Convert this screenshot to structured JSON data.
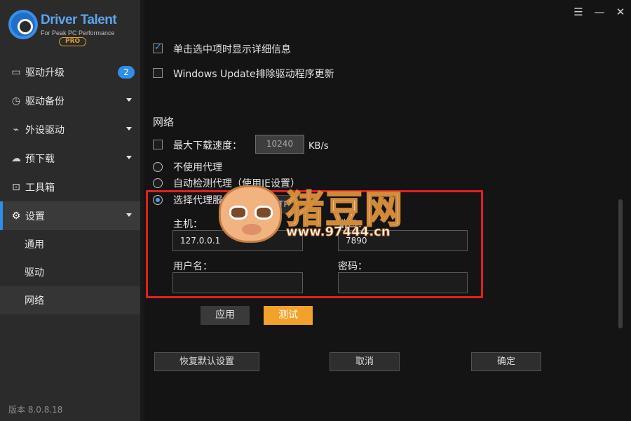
{
  "brand": {
    "title": "Driver Talent",
    "subtitle": "For Peak PC Performance",
    "edition": "PRO"
  },
  "sidebar": {
    "items": [
      {
        "label": "驱动升级",
        "icon": "monitor-icon",
        "badge": "2"
      },
      {
        "label": "驱动备份",
        "icon": "backup-icon"
      },
      {
        "label": "外设驱动",
        "icon": "usb-icon"
      },
      {
        "label": "预下载",
        "icon": "cloud-download-icon"
      },
      {
        "label": "工具箱",
        "icon": "toolbox-icon"
      },
      {
        "label": "设置",
        "icon": "gear-icon"
      }
    ],
    "sub_items": [
      {
        "label": "通用"
      },
      {
        "label": "驱动"
      },
      {
        "label": "网络"
      }
    ],
    "version": "版本 8.0.8.18"
  },
  "window": {
    "menu_icon": "menu-icon",
    "close_icon": "close-icon"
  },
  "settings": {
    "show_details_label": "单击选中项时显示详细信息",
    "exclude_wu_label": "Windows Update排除驱动程序更新",
    "network_title": "网络",
    "max_speed_label": "最大下载速度：",
    "max_speed_value": "10240",
    "speed_unit": "KB/s",
    "no_proxy_label": "不使用代理",
    "auto_proxy_label": "自动检测代理（使用IE设置）",
    "manual_proxy_label": "选择代理服务器",
    "proxy_type": "HTTP",
    "host_label": "主机：",
    "host_value": "127.0.0.1",
    "port_label": "端口：",
    "port_value": "7890",
    "username_label": "用户名：",
    "username_value": "",
    "password_label": "密码：",
    "password_value": "",
    "apply_label": "应用",
    "test_label": "测试",
    "restore_label": "恢复默认设置",
    "cancel_label": "取消",
    "ok_label": "确定"
  },
  "watermark": {
    "title": "猪豆网",
    "url": "www.97444.cn"
  }
}
